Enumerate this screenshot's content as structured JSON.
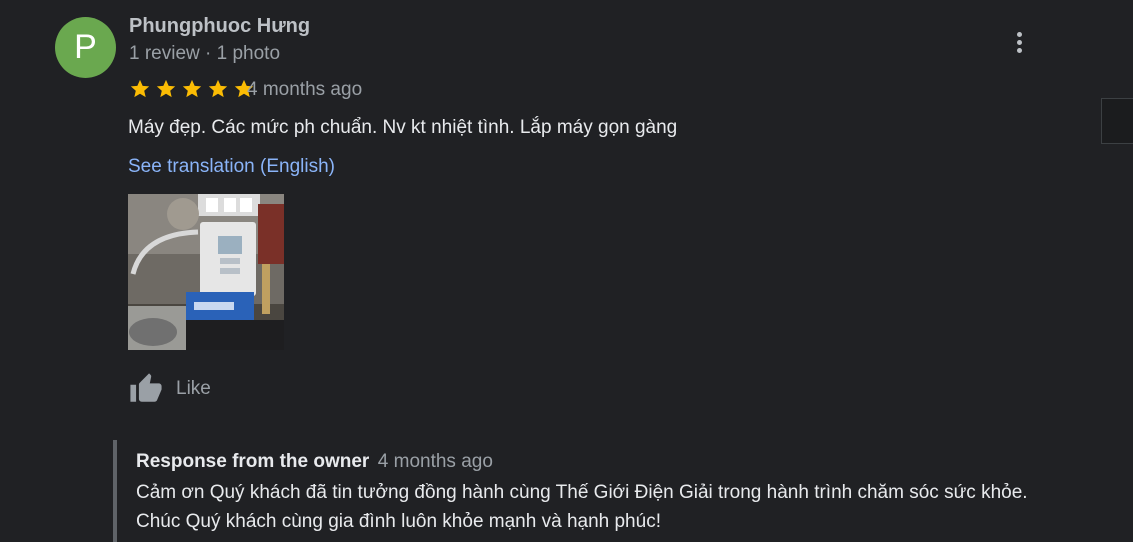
{
  "author": {
    "initial": "P",
    "avatar_color": "#6aa84f",
    "name": "Phungphuoc Hưng",
    "meta": "1 review · 1 photo"
  },
  "review": {
    "rating": 5,
    "max_rating": 5,
    "star_color": "#fbbc04",
    "date": "4 months ago",
    "text": "Máy đẹp. Các mức ph chuẩn. Nv kt nhiệt tình. Lắp máy gọn gàng",
    "translate_link": "See translation (English)",
    "photo_count": 1
  },
  "actions": {
    "like_label": "Like",
    "more_icon": "more-vert-icon"
  },
  "owner_response": {
    "title": "Response from the owner",
    "date": "4 months ago",
    "text": "Cảm ơn Quý khách đã tin tưởng đồng hành cùng Thế Giới Điện Giải trong hành trình chăm sóc sức khỏe. Chúc Quý khách cùng gia đình luôn khỏe mạnh và hạnh phúc!"
  },
  "colors": {
    "background": "#202124",
    "link": "#8ab4f8",
    "text_primary": "#e8eaed",
    "text_secondary": "#9aa0a6"
  }
}
